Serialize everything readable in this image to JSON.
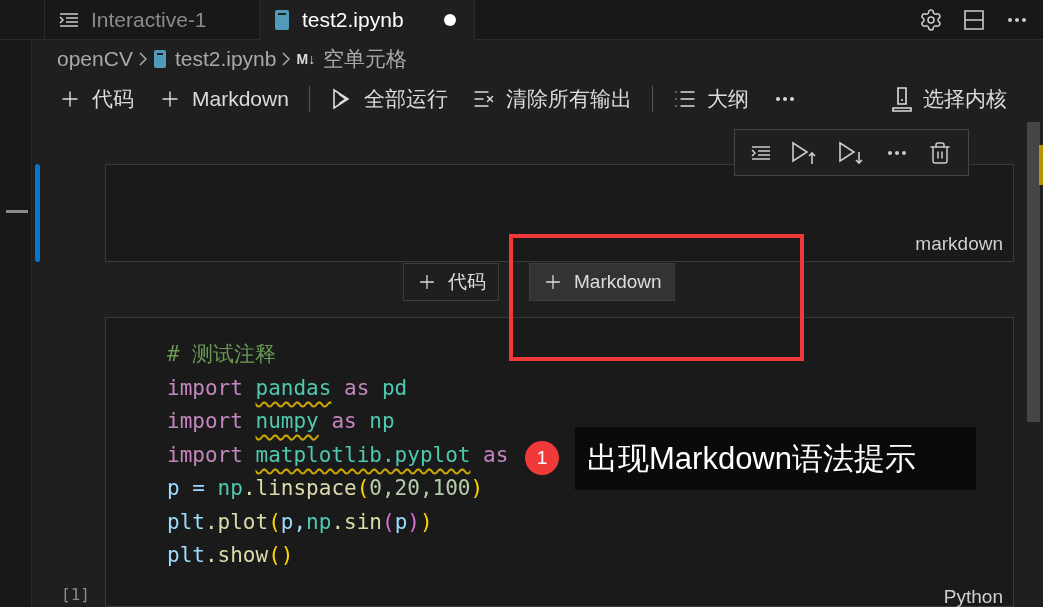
{
  "tabs": [
    {
      "label": "Interactive-1",
      "selected": false,
      "modified": false
    },
    {
      "label": "test2.ipynb",
      "selected": true,
      "modified": true
    }
  ],
  "breadcrumb": [
    {
      "label": "openCV",
      "kind": "folder"
    },
    {
      "label": "test2.ipynb",
      "kind": "notebook"
    },
    {
      "label": "空单元格",
      "kind": "markdown",
      "badge": "M↓"
    }
  ],
  "toolbar": [
    {
      "kind": "add",
      "label": "代码"
    },
    {
      "kind": "add",
      "label": "Markdown"
    },
    {
      "kind": "separator"
    },
    {
      "kind": "run",
      "label": "全部运行"
    },
    {
      "kind": "clear",
      "label": "清除所有输出"
    },
    {
      "kind": "separator"
    },
    {
      "kind": "outline",
      "label": "大纲"
    },
    {
      "kind": "more"
    }
  ],
  "kernel": "选择内核",
  "cells": [
    {
      "kind": "markdown",
      "focused": true,
      "language": "markdown"
    },
    {
      "kind": "code",
      "execution_count": "[1]",
      "language": "Python",
      "lines": [
        [
          {
            "t": "# 测试注释",
            "color": "#6a9955"
          }
        ],
        [
          {
            "t": "import ",
            "color": "#c586c0"
          },
          {
            "t": "pandas",
            "color": "#4ec9b0",
            "squiggle": true
          },
          {
            "t": " as ",
            "color": "#c586c0"
          },
          {
            "t": "pd",
            "color": "#4ec9b0"
          }
        ],
        [
          {
            "t": "import ",
            "color": "#c586c0"
          },
          {
            "t": "numpy",
            "color": "#4ec9b0",
            "squiggle": true
          },
          {
            "t": " as ",
            "color": "#c586c0"
          },
          {
            "t": "np",
            "color": "#4ec9b0"
          }
        ],
        [
          {
            "t": "import ",
            "color": "#c586c0"
          },
          {
            "t": "matplotlib.pyplot",
            "color": "#4ec9b0",
            "squiggle": true
          },
          {
            "t": " as",
            "color": "#c586c0"
          }
        ],
        [
          {
            "t": "p = ",
            "color": "#9cdcfe"
          },
          {
            "t": "np",
            "color": "#4ec9b0"
          },
          {
            "t": ".linspace",
            "color": "#dcdcaa"
          },
          {
            "t": "(",
            "color": "#ffd700"
          },
          {
            "t": "0,20,100",
            "color": "#b5cea8"
          },
          {
            "t": ")",
            "color": "#ffd700"
          }
        ],
        [
          {
            "t": "plt",
            "color": "#9cdcfe"
          },
          {
            "t": ".plot",
            "color": "#dcdcaa"
          },
          {
            "t": "(",
            "color": "#ffd700"
          },
          {
            "t": "p,",
            "color": "#9cdcfe"
          },
          {
            "t": "np",
            "color": "#4ec9b0"
          },
          {
            "t": ".sin",
            "color": "#dcdcaa"
          },
          {
            "t": "(",
            "color": "#da70d6"
          },
          {
            "t": "p",
            "color": "#9cdcfe"
          },
          {
            "t": ")",
            "color": "#da70d6"
          },
          {
            "t": ")",
            "color": "#ffd700"
          }
        ],
        [
          {
            "t": "plt",
            "color": "#9cdcfe"
          },
          {
            "t": ".show",
            "color": "#dcdcaa"
          },
          {
            "t": "()",
            "color": "#ffd700"
          }
        ]
      ]
    }
  ],
  "insert_buttons": [
    {
      "label": "代码",
      "hovered": false
    },
    {
      "label": "Markdown",
      "hovered": true
    }
  ],
  "annotation": {
    "badge": "1",
    "text": "出现Markdown语法提示"
  }
}
